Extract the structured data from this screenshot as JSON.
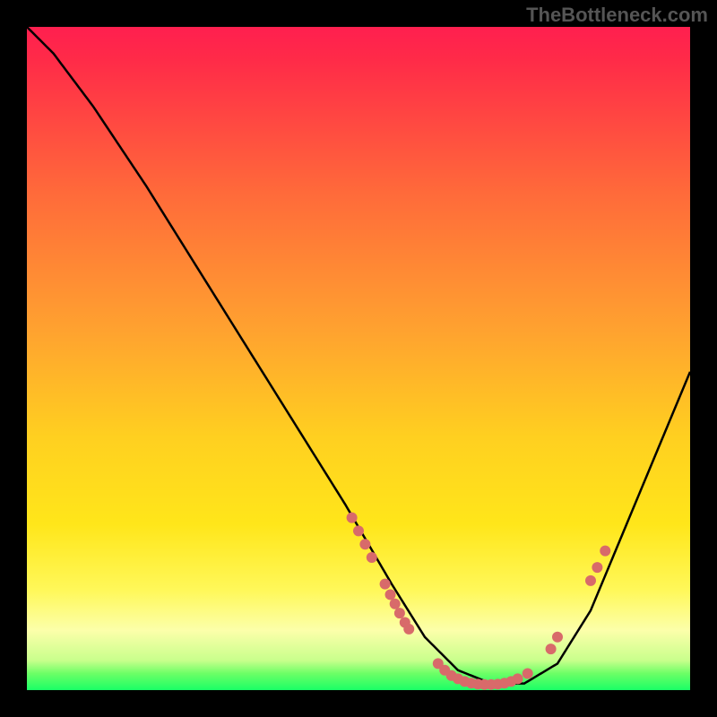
{
  "watermark": "TheBottleneck.com",
  "chart_data": {
    "type": "line",
    "title": "",
    "xlabel": "",
    "ylabel": "",
    "xlim": [
      0,
      100
    ],
    "ylim": [
      0,
      100
    ],
    "gradient_bands": [
      {
        "y_start": 100,
        "y_end": 95,
        "color_top": "#ff1f4f",
        "color_bottom": "#ff2a49"
      },
      {
        "y_start": 95,
        "y_end": 55,
        "color_top": "#ff2a49",
        "color_bottom": "#ffa030"
      },
      {
        "y_start": 55,
        "y_end": 25,
        "color_top": "#ffa030",
        "color_bottom": "#ffe61a"
      },
      {
        "y_start": 25,
        "y_end": 15,
        "color_top": "#ffe61a",
        "color_bottom": "#fff85a"
      },
      {
        "y_start": 15,
        "y_end": 8,
        "color_top": "#fff85a",
        "color_bottom": "#fcffaa"
      },
      {
        "y_start": 8,
        "y_end": 3,
        "color_top": "#fcffaa",
        "color_bottom": "#c9ff8c"
      },
      {
        "y_start": 3,
        "y_end": 0,
        "color_top": "#c9ff8c",
        "color_bottom": "#1aff66"
      }
    ],
    "series": [
      {
        "name": "bottleneck-curve",
        "x": [
          0,
          4,
          10,
          18,
          28,
          38,
          48,
          55,
          60,
          65,
          70,
          75,
          80,
          85,
          90,
          95,
          100
        ],
        "y": [
          100,
          96,
          88,
          76,
          60,
          44,
          28,
          16,
          8,
          3,
          1,
          1,
          4,
          12,
          24,
          36,
          48
        ]
      }
    ],
    "marker_points": {
      "name": "highlighted-points",
      "color": "#d86a6a",
      "points_xy": [
        [
          49,
          26
        ],
        [
          50,
          24
        ],
        [
          51,
          22
        ],
        [
          52,
          20
        ],
        [
          54,
          16
        ],
        [
          54.8,
          14.4
        ],
        [
          55.5,
          13
        ],
        [
          56.2,
          11.6
        ],
        [
          57,
          10.2
        ],
        [
          57.6,
          9.2
        ],
        [
          62,
          4.0
        ],
        [
          63,
          3.0
        ],
        [
          64,
          2.2
        ],
        [
          65,
          1.7
        ],
        [
          66,
          1.3
        ],
        [
          67,
          1.05
        ],
        [
          68,
          0.9
        ],
        [
          69,
          0.85
        ],
        [
          70,
          0.85
        ],
        [
          71,
          0.9
        ],
        [
          72,
          1.05
        ],
        [
          73,
          1.3
        ],
        [
          74,
          1.7
        ],
        [
          75.5,
          2.5
        ],
        [
          79,
          6.2
        ],
        [
          80,
          8.0
        ],
        [
          85,
          16.5
        ],
        [
          86,
          18.5
        ],
        [
          87.2,
          21.0
        ]
      ]
    }
  }
}
